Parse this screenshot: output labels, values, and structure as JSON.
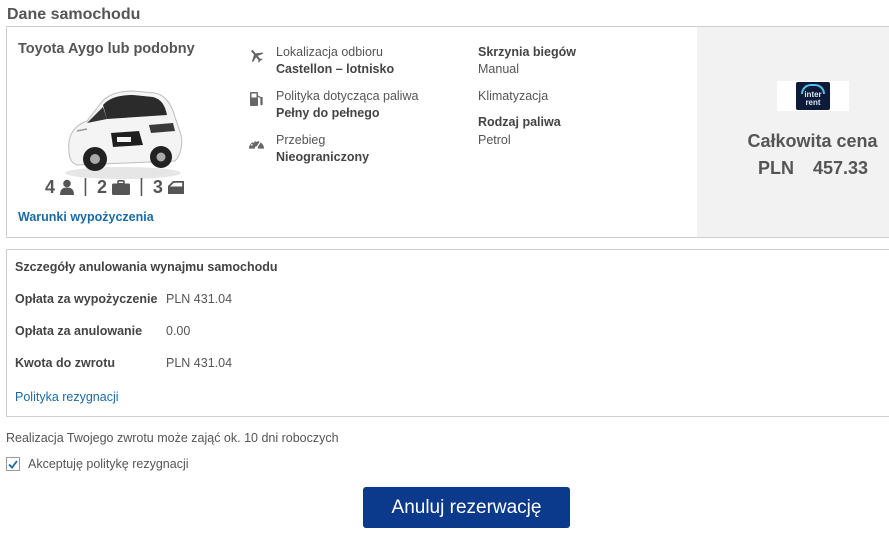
{
  "section_title": "Dane samochodu",
  "car": {
    "name": "Toyota Aygo lub podobny",
    "image_icon": "car-photo",
    "capacity": [
      {
        "value": "4",
        "icon": "person-icon"
      },
      {
        "value": "2",
        "icon": "suitcase-icon"
      },
      {
        "value": "3",
        "icon": "car-door-icon"
      }
    ],
    "rental_terms_link": "Warunki wypożyczenia"
  },
  "details": [
    {
      "icon": "plane-icon",
      "label": "Lokalizacja odbioru",
      "value": "Castellon – lotnisko"
    },
    {
      "icon": "fuel-pump-icon",
      "label": "Polityka dotycząca paliwa",
      "value": "Pełny do pełnego"
    },
    {
      "icon": "speedometer-icon",
      "label": "Przebieg",
      "value": "Nieograniczony"
    }
  ],
  "specs": {
    "gearbox_label": "Skrzynia biegów",
    "gearbox_value": "Manual",
    "aircon": "Klimatyzacja",
    "fuel_type_label": "Rodzaj paliwa",
    "fuel_type_value": "Petrol"
  },
  "supplier": {
    "logo_text_line1": "inter",
    "logo_text_line2": "rent"
  },
  "price": {
    "label": "Całkowita cena",
    "currency": "PLN",
    "amount": "457.33"
  },
  "cancellation": {
    "title": "Szczegóły anulowania wynajmu samochodu",
    "rows": [
      {
        "label": "Opłata za wypożyczenie",
        "value": "PLN 431.04"
      },
      {
        "label": "Opłata za anulowanie",
        "value": "0.00"
      },
      {
        "label": "Kwota do zwrotu",
        "value": "PLN 431.04"
      }
    ],
    "policy_link": "Polityka rezygnacji"
  },
  "refund_note": "Realizacja Twojego zwrotu może zająć ok. 10 dni roboczych",
  "accept": {
    "label": "Akceptuję politykę rezygnacji",
    "checked": true
  },
  "cancel_button_label": "Anuluj rezerwację",
  "colors": {
    "link": "#1a6ba5",
    "button": "#0b3a8c",
    "price_panel": "#f2f2f2"
  }
}
